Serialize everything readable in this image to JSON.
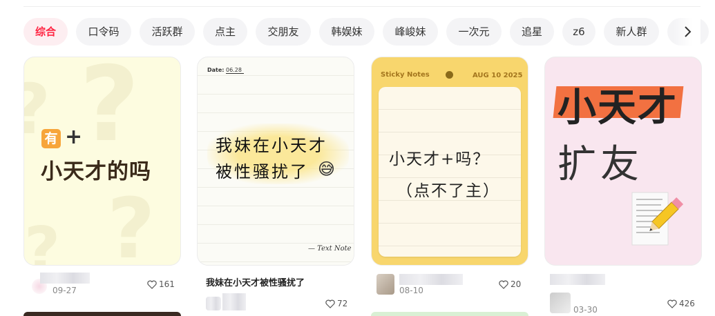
{
  "tags": [
    "综合",
    "口令码",
    "活跃群",
    "点主",
    "交朋友",
    "韩娱妹",
    "峰峻妹",
    "一次元",
    "追星",
    "z6",
    "新人群"
  ],
  "cards": [
    {
      "badge": "有",
      "plus": "+",
      "headline": "小天才的吗",
      "date": "09-27",
      "likes": "161"
    },
    {
      "date_label": "Date:",
      "date_value": "06.28",
      "line1": "我妹在小天才",
      "line2": "被性骚扰了",
      "emoji": "😅",
      "footer": "— Text Note",
      "title": "我妹在小天才被性骚扰了",
      "likes": "72"
    },
    {
      "header_left": "Sticky Notes",
      "header_right": "AUG 10 2025",
      "line1": "小天才+吗？",
      "line2": "（点不了主）",
      "date": "08-10",
      "likes": "20"
    },
    {
      "line1": "小天才",
      "line2": "扩友",
      "date": "03-30",
      "likes": "426"
    }
  ],
  "icons": {
    "next": "chevron-right-icon",
    "like": "heart-outline-icon",
    "pencil": "pencil-paper-icon"
  },
  "colors": {
    "accent": "#ff2442",
    "note_yellow": "#f8d66d",
    "highlight": "#f27141"
  }
}
